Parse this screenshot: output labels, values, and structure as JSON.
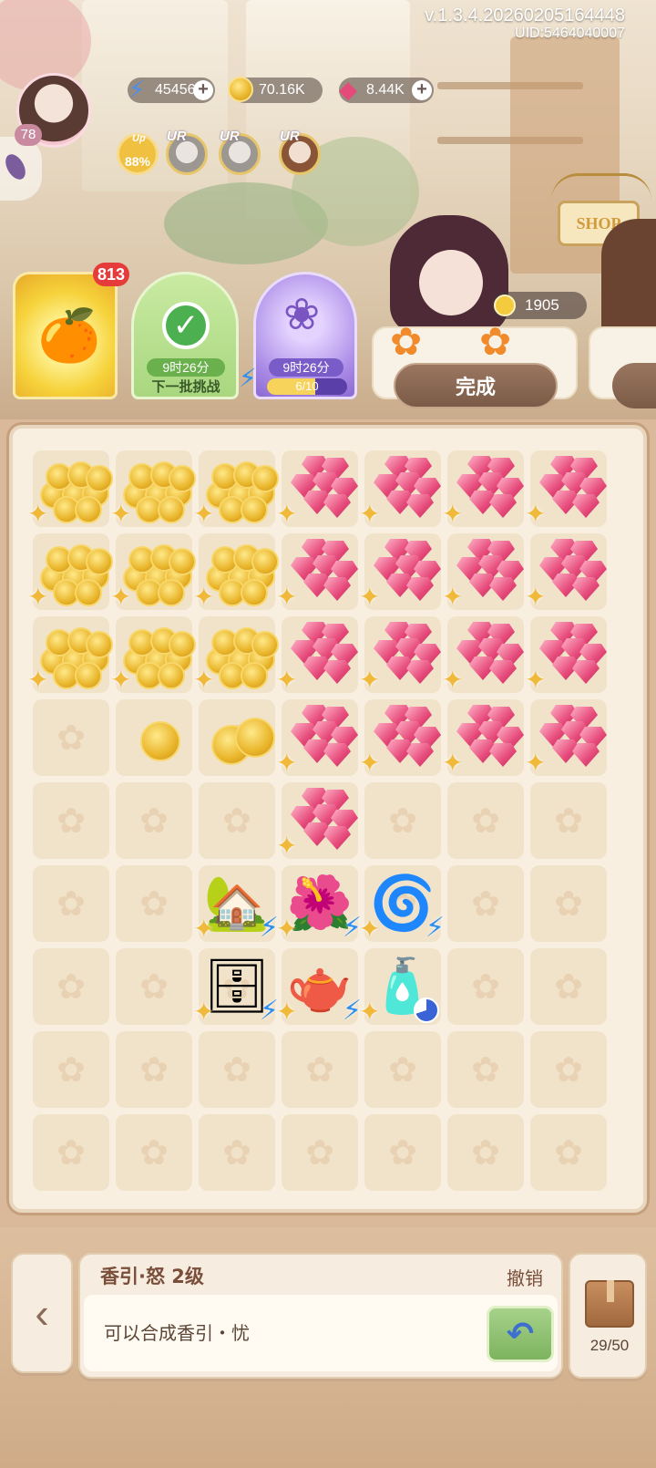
{
  "header": {
    "version": "v.1.3.4.20260205164448",
    "uid": "UID:5464040007"
  },
  "player": {
    "level": "78"
  },
  "resources": {
    "energy": "45456",
    "gold": "70.16K",
    "gems": "8.44K"
  },
  "boosts": {
    "up_label": "Up",
    "percent": "88%",
    "ur_label": "UR"
  },
  "shop": {
    "label": "SHOP"
  },
  "orders": {
    "badge_count": "813",
    "green_card": {
      "timer": "9时26分",
      "caption": "下一批挑战"
    },
    "purple_card": {
      "timer": "9时26分",
      "progress_text": "6/10",
      "progress_fraction": 0.6
    },
    "reward_coins": "1905",
    "complete_label": "完成"
  },
  "board": {
    "rows": 9,
    "cols": 7,
    "items": [
      {
        "r": 0,
        "c": 0,
        "type": "coins"
      },
      {
        "r": 0,
        "c": 1,
        "type": "coins"
      },
      {
        "r": 0,
        "c": 2,
        "type": "coins"
      },
      {
        "r": 0,
        "c": 3,
        "type": "gems"
      },
      {
        "r": 0,
        "c": 4,
        "type": "gems"
      },
      {
        "r": 0,
        "c": 5,
        "type": "gems"
      },
      {
        "r": 0,
        "c": 6,
        "type": "gems"
      },
      {
        "r": 1,
        "c": 0,
        "type": "coins"
      },
      {
        "r": 1,
        "c": 1,
        "type": "coins"
      },
      {
        "r": 1,
        "c": 2,
        "type": "coins"
      },
      {
        "r": 1,
        "c": 3,
        "type": "gems"
      },
      {
        "r": 1,
        "c": 4,
        "type": "gems"
      },
      {
        "r": 1,
        "c": 5,
        "type": "gems"
      },
      {
        "r": 1,
        "c": 6,
        "type": "gems"
      },
      {
        "r": 2,
        "c": 0,
        "type": "coins"
      },
      {
        "r": 2,
        "c": 1,
        "type": "coins"
      },
      {
        "r": 2,
        "c": 2,
        "type": "coins"
      },
      {
        "r": 2,
        "c": 3,
        "type": "gems"
      },
      {
        "r": 2,
        "c": 4,
        "type": "gems"
      },
      {
        "r": 2,
        "c": 5,
        "type": "gems"
      },
      {
        "r": 2,
        "c": 6,
        "type": "gems"
      },
      {
        "r": 3,
        "c": 1,
        "type": "coin-single"
      },
      {
        "r": 3,
        "c": 2,
        "type": "coin-double"
      },
      {
        "r": 3,
        "c": 3,
        "type": "gems"
      },
      {
        "r": 3,
        "c": 4,
        "type": "gems"
      },
      {
        "r": 3,
        "c": 5,
        "type": "gems"
      },
      {
        "r": 3,
        "c": 6,
        "type": "gems"
      },
      {
        "r": 4,
        "c": 3,
        "type": "gems"
      },
      {
        "r": 5,
        "c": 2,
        "type": "greenhouse"
      },
      {
        "r": 5,
        "c": 3,
        "type": "flower-cart"
      },
      {
        "r": 5,
        "c": 4,
        "type": "portal"
      },
      {
        "r": 6,
        "c": 2,
        "type": "cabinet"
      },
      {
        "r": 6,
        "c": 3,
        "type": "teapot"
      },
      {
        "r": 6,
        "c": 4,
        "type": "perfume"
      }
    ]
  },
  "info": {
    "title": "香引·怒 2级",
    "undo_label": "撤销",
    "description": "可以合成香引・忧"
  },
  "bag": {
    "count": "29/50"
  }
}
